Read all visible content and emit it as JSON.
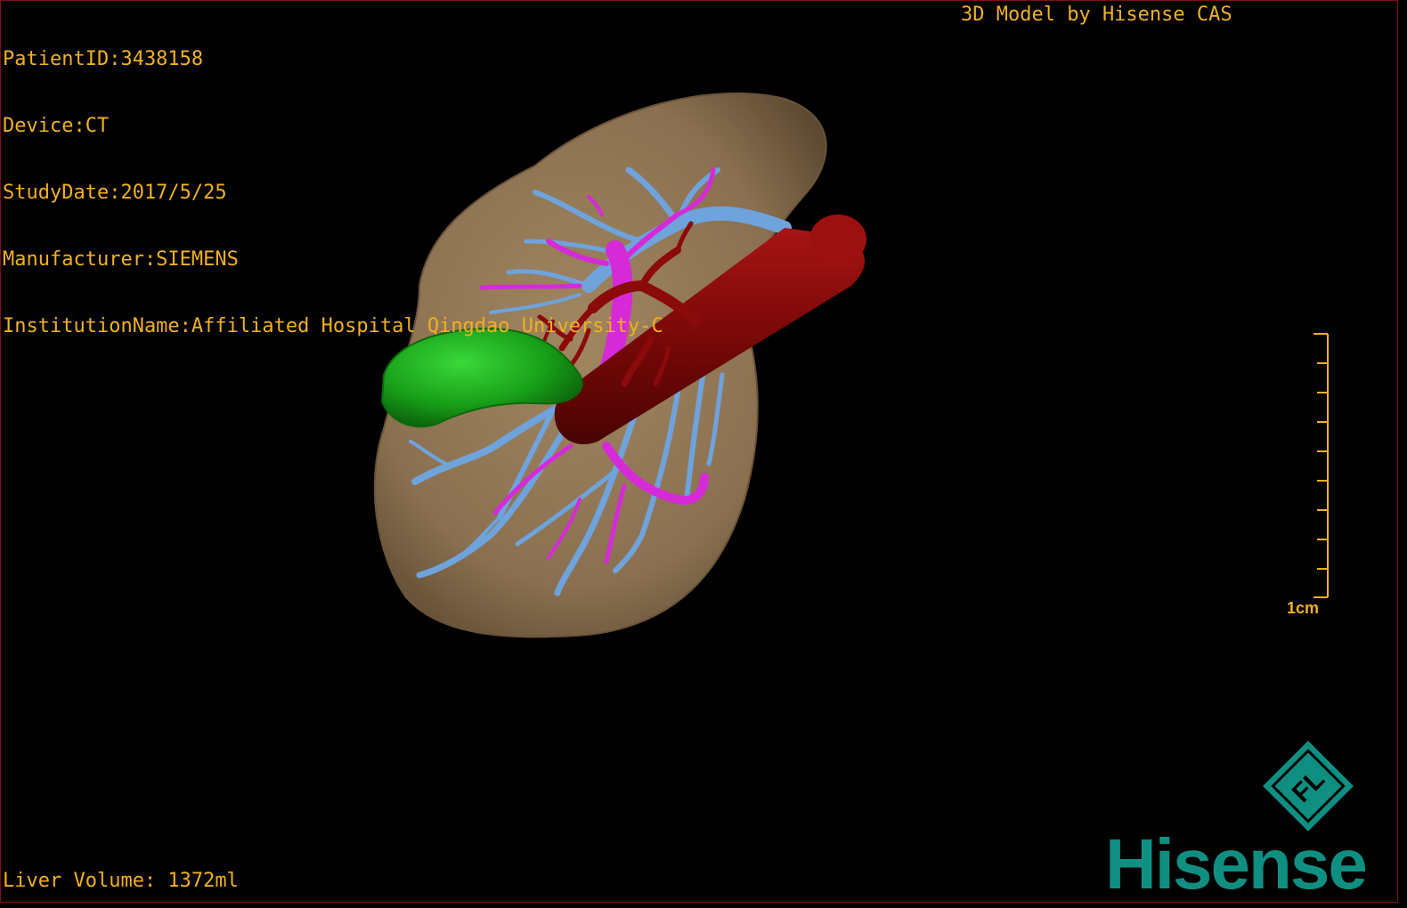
{
  "header": {
    "patient_id": "PatientID:3438158",
    "device": "Device:CT",
    "study_date": "StudyDate:2017/5/25",
    "manufacturer": "Manufacturer:SIEMENS",
    "institution": "InstitutionName:Affiliated Hospital Qingdao University-C"
  },
  "credit": "3D Model by Hisense CAS",
  "footer": {
    "liver_volume": "Liver Volume: 1372ml"
  },
  "scale": {
    "label": "1cm"
  },
  "brand": {
    "name": "Hisense",
    "emblem_letters": "FL",
    "color": "#0f8f82"
  },
  "colors": {
    "overlay_text": "#f0b020",
    "liver": "#8f7650",
    "portal_vein": "#6fa3dc",
    "hepatic_vein": "#d62ad8",
    "artery_ivc": "#8b0a0a",
    "gallbladder": "#1aa51a"
  }
}
